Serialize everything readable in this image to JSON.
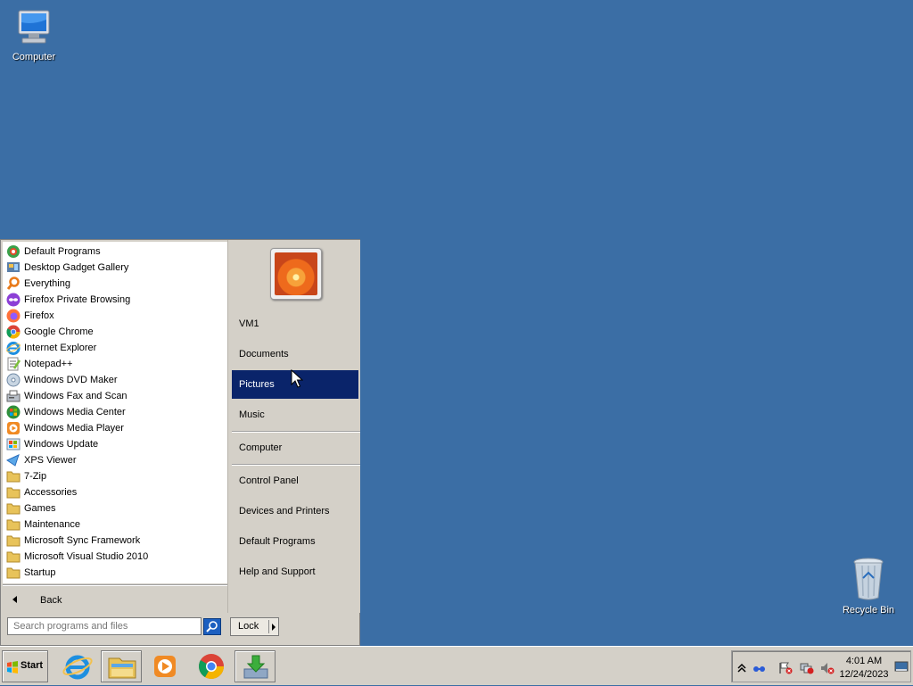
{
  "desktop": {
    "computer_label": "Computer",
    "recycle_label": "Recycle Bin",
    "background": "#3b6ea5"
  },
  "start_menu": {
    "programs": [
      {
        "label": "Default Programs",
        "icon": "default-programs-icon"
      },
      {
        "label": "Desktop Gadget Gallery",
        "icon": "gadget-gallery-icon"
      },
      {
        "label": "Everything",
        "icon": "everything-search-icon"
      },
      {
        "label": "Firefox Private Browsing",
        "icon": "firefox-private-icon"
      },
      {
        "label": "Firefox",
        "icon": "firefox-icon"
      },
      {
        "label": "Google Chrome",
        "icon": "chrome-icon"
      },
      {
        "label": "Internet Explorer",
        "icon": "ie-icon"
      },
      {
        "label": "Notepad++",
        "icon": "notepadpp-icon"
      },
      {
        "label": "Windows DVD Maker",
        "icon": "dvd-maker-icon"
      },
      {
        "label": "Windows Fax and Scan",
        "icon": "fax-scan-icon"
      },
      {
        "label": "Windows Media Center",
        "icon": "media-center-icon"
      },
      {
        "label": "Windows Media Player",
        "icon": "media-player-icon"
      },
      {
        "label": "Windows Update",
        "icon": "windows-update-icon"
      },
      {
        "label": "XPS Viewer",
        "icon": "xps-viewer-icon"
      },
      {
        "label": "7-Zip",
        "icon": "folder-icon"
      },
      {
        "label": "Accessories",
        "icon": "folder-icon"
      },
      {
        "label": "Games",
        "icon": "folder-icon"
      },
      {
        "label": "Maintenance",
        "icon": "folder-icon"
      },
      {
        "label": "Microsoft Sync Framework",
        "icon": "folder-icon"
      },
      {
        "label": "Microsoft Visual Studio 2010",
        "icon": "folder-icon"
      },
      {
        "label": "Startup",
        "icon": "folder-icon"
      }
    ],
    "back_label": "Back",
    "search_placeholder": "Search programs and files",
    "right_items": [
      {
        "label": "VM1"
      },
      {
        "label": "Documents"
      },
      {
        "label": "Pictures",
        "selected": true
      },
      {
        "label": "Music"
      },
      {
        "label": "Computer"
      },
      {
        "label": "Control Panel"
      },
      {
        "label": "Devices and Printers"
      },
      {
        "label": "Default Programs"
      },
      {
        "label": "Help and Support"
      }
    ],
    "lock_label": "Lock",
    "selection_color": "#0a246a"
  },
  "taskbar": {
    "start_label": "Start",
    "pinned": [
      "ie-icon",
      "explorer-icon",
      "media-player-icon",
      "chrome-icon",
      "installer-icon"
    ],
    "clock_time": "4:01 AM",
    "clock_date": "12/24/2023"
  }
}
